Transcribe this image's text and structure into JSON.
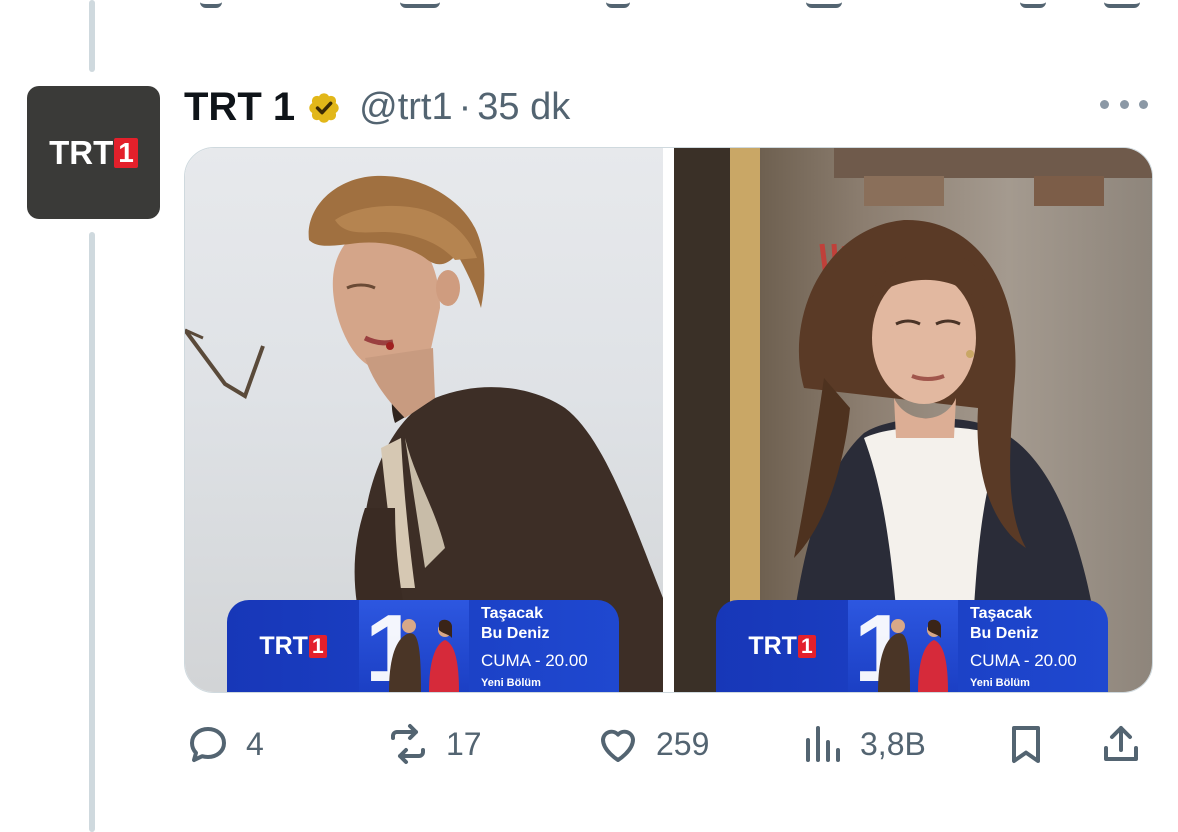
{
  "tweet": {
    "author": {
      "name": "TRT 1",
      "handle": "@trt1",
      "verified_badge": "gold-verified-icon",
      "avatar_logo": {
        "letters": "TRT",
        "number": "1"
      }
    },
    "separator": "·",
    "time": "35 dk",
    "media": [
      {
        "banner": {
          "logo_letters": "TRT",
          "logo_number": "1",
          "big_number": "1",
          "title_line1": "Taşacak",
          "title_line2": "Bu Deniz",
          "schedule": "CUMA - 20.00",
          "note": "Yeni Bölüm"
        }
      },
      {
        "banner": {
          "logo_letters": "TRT",
          "logo_number": "1",
          "big_number": "1",
          "title_line1": "Taşacak",
          "title_line2": "Bu Deniz",
          "schedule": "CUMA - 20.00",
          "note": "Yeni Bölüm"
        }
      }
    ],
    "actions": {
      "replies": "4",
      "retweets": "17",
      "likes": "259",
      "views": "3,8B"
    }
  },
  "colors": {
    "text_primary": "#0f1419",
    "text_secondary": "#536471",
    "thread_line": "#cfd9de",
    "brand_red": "#e3202b",
    "banner_blue": "#1f48d0",
    "verified_gold": "#e2b719"
  }
}
